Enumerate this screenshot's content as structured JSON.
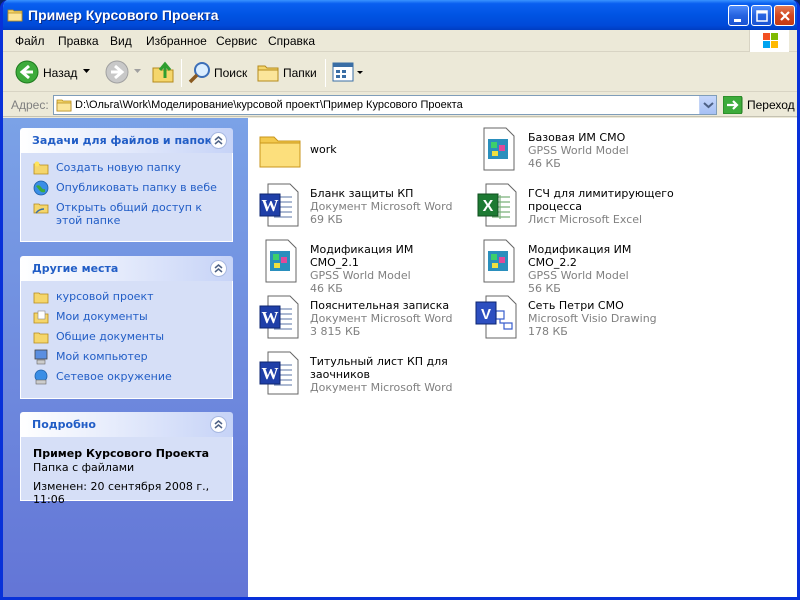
{
  "window": {
    "title": "Пример Курсового Проекта"
  },
  "menu": [
    "Файл",
    "Правка",
    "Вид",
    "Избранное",
    "Сервис",
    "Справка"
  ],
  "toolbar": {
    "back": "Назад",
    "search": "Поиск",
    "folders": "Папки"
  },
  "address": {
    "label": "Адрес:",
    "value": "D:\\Ольга\\Work\\Моделирование\\курсовой проект\\Пример Курсового Проекта",
    "go": "Переход"
  },
  "tasks": {
    "title": "Задачи для файлов и папок",
    "items": [
      "Создать новую папку",
      "Опубликовать папку в вебе",
      "Открыть общий доступ к этой папке"
    ]
  },
  "places": {
    "title": "Другие места",
    "items": [
      "курсовой проект",
      "Мои документы",
      "Общие документы",
      "Мой компьютер",
      "Сетевое окружение"
    ]
  },
  "details": {
    "title": "Подробно",
    "name": "Пример Курсового Проекта",
    "type": "Папка с файлами",
    "modified": "Изменен: 20 сентября 2008 г., 11:06"
  },
  "files": [
    {
      "name": "work",
      "type": "",
      "size": "",
      "icon": "folder-icon"
    },
    {
      "name": "Базовая ИМ СМО",
      "type": "GPSS World Model",
      "size": "46 КБ",
      "icon": "gpss-model-icon"
    },
    {
      "name": "Бланк защиты КП",
      "type": "Документ Microsoft Word",
      "size": "69 КБ",
      "icon": "word-document-icon"
    },
    {
      "name": "ГСЧ для лимитирующего процесса",
      "type": "Лист Microsoft Excel",
      "size": "",
      "icon": "excel-sheet-icon"
    },
    {
      "name": "Модификация ИМ СМО_2.1",
      "type": "GPSS World Model",
      "size": "46 КБ",
      "icon": "gpss-model-icon"
    },
    {
      "name": "Модификация ИМ СМО_2.2",
      "type": "GPSS World Model",
      "size": "56 КБ",
      "icon": "gpss-model-icon"
    },
    {
      "name": "Пояснительная записка",
      "type": "Документ Microsoft Word",
      "size": "3 815 КБ",
      "icon": "word-document-icon"
    },
    {
      "name": "Сеть Петри СМО",
      "type": "Microsoft Visio Drawing",
      "size": "178 КБ",
      "icon": "visio-drawing-icon"
    },
    {
      "name": "Титульный лист КП для заочников",
      "type": "Документ Microsoft Word",
      "size": "",
      "icon": "word-document-icon"
    }
  ],
  "colors": {
    "titlebar": "#0054e3",
    "taskpane": "#7ba2e7",
    "link": "#215dc6"
  }
}
